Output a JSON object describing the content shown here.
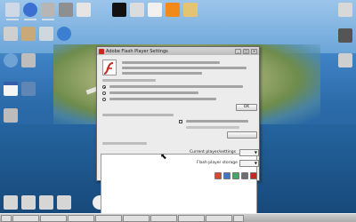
{
  "window": {
    "title": "Adobe Flash Player Settings",
    "title_icon": "flash-icon",
    "controls": [
      "_",
      "□",
      "×"
    ],
    "logo_icon": "flash-logo-icon",
    "actions": {
      "ok_label": "OK"
    },
    "fields": [
      {
        "label": "Current player/settings",
        "value": ""
      },
      {
        "label": "Flash player storage",
        "value": ""
      }
    ]
  },
  "desktop": {
    "icons": [
      "computer-icon",
      "info-icon",
      "printer-icon",
      "terminal-icon",
      "display-icon",
      "network-icon",
      "document-icon",
      "rss-icon",
      "folder-icon",
      "trash-icon"
    ]
  },
  "colors": {
    "accent": "#c7281e",
    "window_bg": "#ececec",
    "taskbar": "#bfbfbf"
  }
}
